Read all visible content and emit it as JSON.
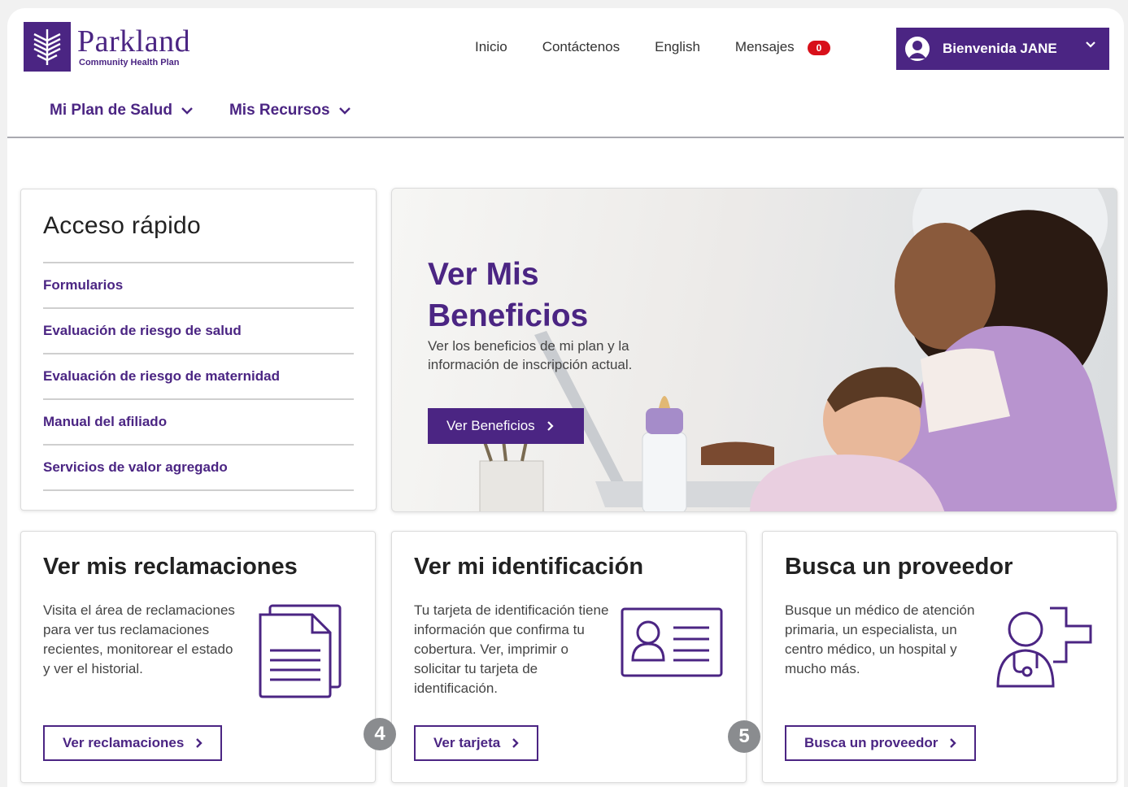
{
  "brand": {
    "name": "Parkland",
    "sub": "Community Health Plan",
    "color": "#4b2583"
  },
  "topnav": {
    "home": "Inicio",
    "contact": "Contáctenos",
    "language": "English",
    "messages": "Mensajes",
    "messages_count": "0"
  },
  "user": {
    "welcome": "Bienvenida JANE"
  },
  "subnav": {
    "plan": "Mi Plan de Salud",
    "resources": "Mis Recursos"
  },
  "quick_access": {
    "title": "Acceso rápido",
    "items": [
      "Formularios",
      "Evaluación de riesgo de salud",
      "Evaluación de riesgo de maternidad",
      "Manual del afiliado",
      "Servicios de valor agregado"
    ]
  },
  "hero": {
    "title_line1": "Ver Mis",
    "title_line2": "Beneficios",
    "description": "Ver los beneficios de mi plan y la información de inscripción actual.",
    "button": "Ver Beneficios"
  },
  "cards": {
    "claims": {
      "title": "Ver mis reclamaciones",
      "text": "Visita el área de reclamaciones para ver tus reclamaciones recientes, monitorear el estado y ver el historial.",
      "button": "Ver reclamaciones"
    },
    "id": {
      "title": "Ver mi identificación",
      "text": "Tu tarjeta de identificación tiene información que confirma tu cobertura. Ver, imprimir o solicitar tu tarjeta de identificación.",
      "button": "Ver tarjeta"
    },
    "provider": {
      "title": "Busca un proveedor",
      "text": "Busque un médico de atención primaria, un especialista, un centro médico, un hospital y mucho más.",
      "button": "Busca un proveedor"
    }
  },
  "callouts": {
    "four": "4",
    "five": "5"
  }
}
